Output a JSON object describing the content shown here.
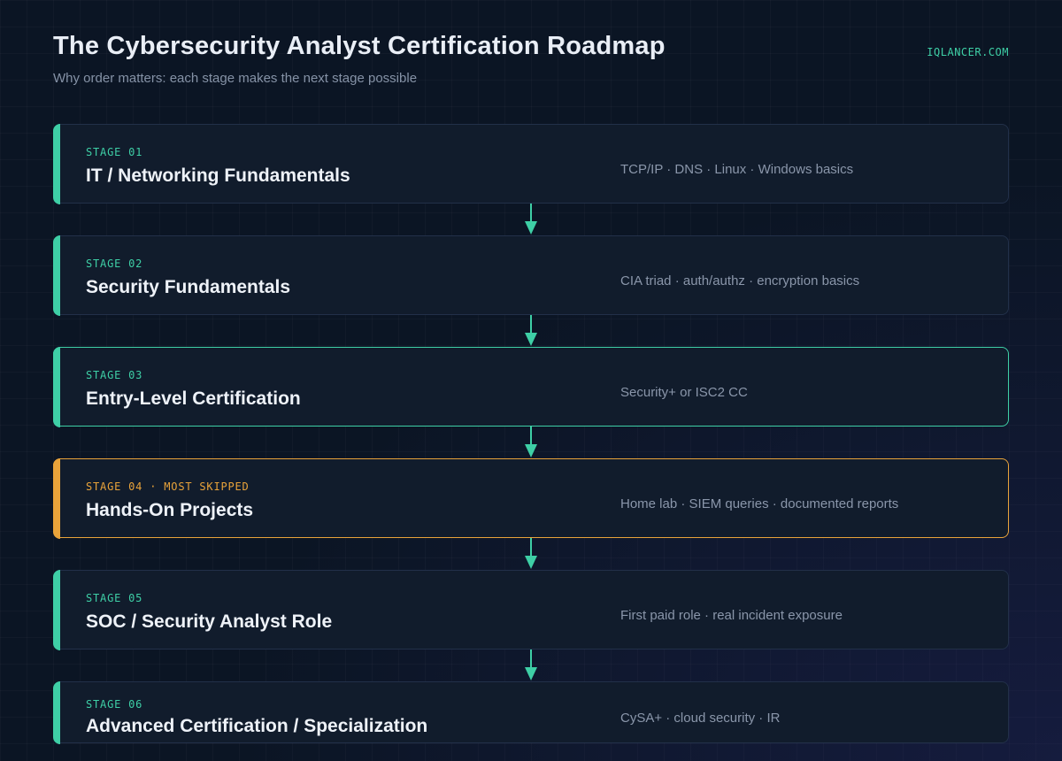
{
  "header": {
    "title": "The Cybersecurity Analyst Certification Roadmap",
    "subtitle": "Why order matters: each stage makes the next stage possible",
    "brand": "IQLANCER.COM"
  },
  "colors": {
    "accent": "#3ecfa6",
    "warning": "#e9a33a",
    "background": "#0b1524",
    "card": "#111c2c"
  },
  "stages": [
    {
      "label": "STAGE 01",
      "title": "IT / Networking Fundamentals",
      "detail": "TCP/IP · DNS · Linux · Windows basics"
    },
    {
      "label": "STAGE 02",
      "title": "Security Fundamentals",
      "detail": "CIA triad · auth/authz · encryption basics"
    },
    {
      "label": "STAGE 03",
      "title": "Entry-Level Certification",
      "detail": "Security+ or ISC2 CC"
    },
    {
      "label": "STAGE 04 · MOST SKIPPED",
      "title": "Hands-On Projects",
      "detail": "Home lab · SIEM queries · documented reports"
    },
    {
      "label": "STAGE 05",
      "title": "SOC / Security Analyst Role",
      "detail": "First paid role · real incident exposure"
    },
    {
      "label": "STAGE 06",
      "title": "Advanced Certification / Specialization",
      "detail": "CySA+ · cloud security · IR"
    }
  ]
}
